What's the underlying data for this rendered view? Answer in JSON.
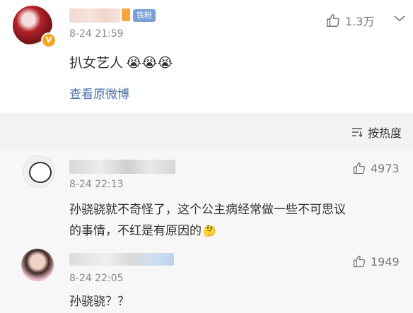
{
  "post": {
    "fan_badge": "铁粉",
    "time": "8-24 21:59",
    "likes": "1.3万",
    "text": "扒女艺人",
    "emoji": "😭😭😭",
    "view_original": "查看原微博"
  },
  "sort": {
    "label": "按热度"
  },
  "comments": [
    {
      "time": "8-24 22:13",
      "likes": "4973",
      "text_line1": "孙骁骁就不奇怪了，这个公主病经常做一些不可思议",
      "text_line2": "的事情，不红是有原因的",
      "emoji": "🤔"
    },
    {
      "time": "8-24 22:05",
      "likes": "1949",
      "text_line1": "孙骁骁？？"
    }
  ],
  "colors": {
    "link_blue": "#4a6fa5",
    "verified_orange": "#f5a623",
    "fan_badge_blue": "#7aa0d8"
  }
}
